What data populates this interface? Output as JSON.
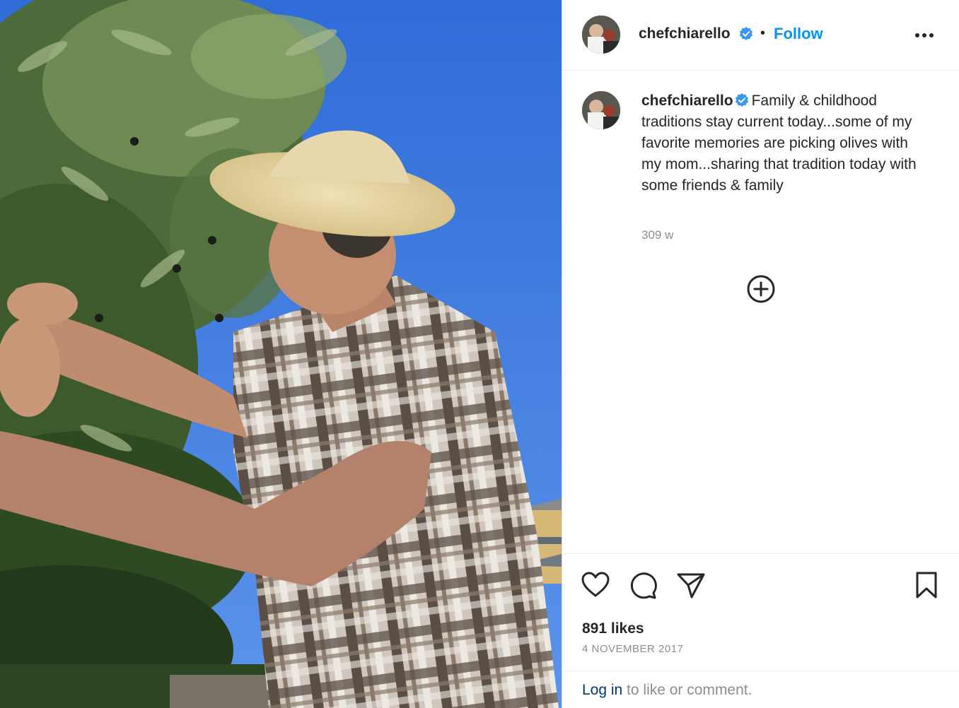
{
  "post": {
    "username": "chefchiarello",
    "follow_label": "Follow",
    "separator": "•",
    "caption": "Family & childhood traditions stay current today...some of my favorite memories are picking olives with my mom...sharing that tradition today with some friends & family",
    "time_ago": "309 w",
    "likes": "891 likes",
    "date": "4 NOVEMBER 2017"
  },
  "login_bar": {
    "link": "Log in",
    "rest": " to like or comment."
  },
  "icons": {
    "verified": "verified-badge-icon",
    "more": "more-options-icon",
    "add": "add-circle-icon",
    "like": "heart-icon",
    "comment": "comment-icon",
    "share": "send-icon",
    "save": "bookmark-icon"
  },
  "colors": {
    "link_blue": "#0095f6",
    "verified_blue": "#3897f0",
    "muted_text": "#8e8e8e",
    "login_link": "#00376b"
  }
}
